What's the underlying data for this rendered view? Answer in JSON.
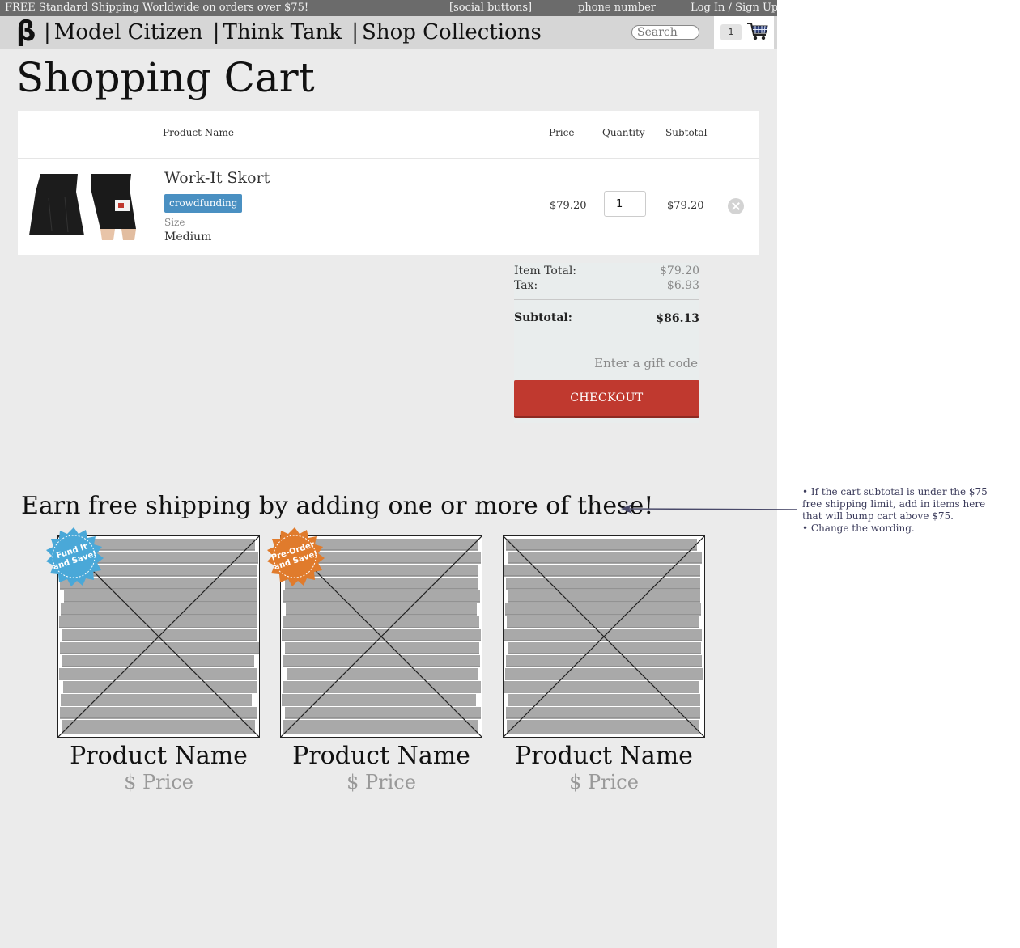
{
  "topbar": {
    "promo": "FREE Standard Shipping Worldwide on orders over $75!",
    "social": "[social buttons]",
    "phone": "phone number",
    "login": "Log In / Sign Up"
  },
  "nav": {
    "logo": "β",
    "links": [
      "Model Citizen",
      "Think Tank",
      "Shop Collections"
    ],
    "separator": "|",
    "search_placeholder": "Search",
    "cart_count": "1"
  },
  "page_title": "Shopping Cart",
  "cart": {
    "headers": {
      "name": "Product Name",
      "price": "Price",
      "quantity": "Quantity",
      "subtotal": "Subtotal"
    },
    "items": [
      {
        "name": "Work-It Skort",
        "tag": "crowdfunding",
        "option_label": "Size",
        "option_value": "Medium",
        "price": "$79.20",
        "quantity": "1",
        "subtotal": "$79.20"
      }
    ]
  },
  "totals": {
    "item_total_label": "Item Total:",
    "item_total": "$79.20",
    "tax_label": "Tax:",
    "tax": "$6.93",
    "subtotal_label": "Subtotal:",
    "subtotal": "$86.13",
    "gift_placeholder": "Enter a gift code",
    "checkout_label": "CHECKOUT"
  },
  "upsell": {
    "title": "Earn free shipping by adding one or more of these!",
    "products": [
      {
        "name": "Product Name",
        "price": "$ Price",
        "badge": "Fund It and Save!",
        "badge_color": "#4aa8d8"
      },
      {
        "name": "Product Name",
        "price": "$ Price",
        "badge": "Pre-Order and Save!",
        "badge_color": "#e07b2c"
      },
      {
        "name": "Product Name",
        "price": "$ Price"
      }
    ]
  },
  "annotation": {
    "notes": [
      "• If the cart subtotal is under the $75 free shipping limit, add in items here that will bump cart above $75.",
      "• Change the wording."
    ]
  },
  "colors": {
    "checkout": "#c0392f",
    "tag": "#4a90c2",
    "topbar": "#6b6b6b",
    "navbar": "#d6d6d6"
  }
}
